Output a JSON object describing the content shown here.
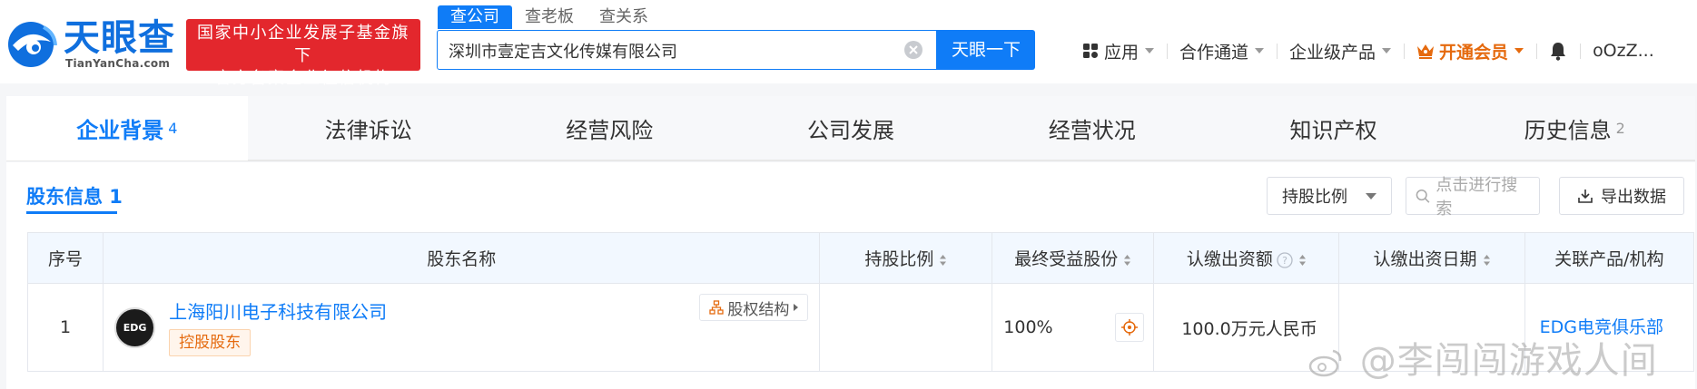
{
  "header": {
    "logo_name": "天眼查",
    "logo_domain": "TianYanCha.com",
    "badge_line1": "国家中小企业发展子基金旗下",
    "badge_line2": "官方备案企业征信机构",
    "search_tabs": [
      "查公司",
      "查老板",
      "查关系"
    ],
    "search_value": "深圳市壹定吉文化传媒有限公司",
    "search_button": "天眼一下",
    "nav": {
      "apps": "应用",
      "partner": "合作通道",
      "enterprise": "企业级产品",
      "vip": "开通会员",
      "user": "oOzZ..."
    }
  },
  "tabs": [
    {
      "label": "企业背景",
      "count": "4"
    },
    {
      "label": "法律诉讼",
      "count": ""
    },
    {
      "label": "经营风险",
      "count": ""
    },
    {
      "label": "公司发展",
      "count": ""
    },
    {
      "label": "经营状况",
      "count": ""
    },
    {
      "label": "知识产权",
      "count": ""
    },
    {
      "label": "历史信息",
      "count": "2"
    }
  ],
  "section": {
    "title": "股东信息 1",
    "ratio_filter": "持股比例",
    "search_placeholder": "点击进行搜索",
    "export": "导出数据"
  },
  "table": {
    "headers": {
      "index": "序号",
      "name": "股东名称",
      "ratio": "持股比例",
      "benefit": "最终受益股份",
      "amount": "认缴出资额",
      "date": "认缴出资日期",
      "product": "关联产品/机构"
    },
    "rows": [
      {
        "index": "1",
        "avatar": "EDG",
        "name": "上海阳川电子科技有限公司",
        "tag": "控股股东",
        "equity": "股权结构",
        "ratio": "",
        "benefit": "100%",
        "amount": "100.0万元人民币",
        "date": "",
        "product": "EDG电竞俱乐部"
      }
    ]
  },
  "watermark": "@李闯闯游戏人间",
  "colors": {
    "brand_blue": "#0f7cf7",
    "badge_red": "#e3272d",
    "vip_orange": "#e56a0e"
  }
}
